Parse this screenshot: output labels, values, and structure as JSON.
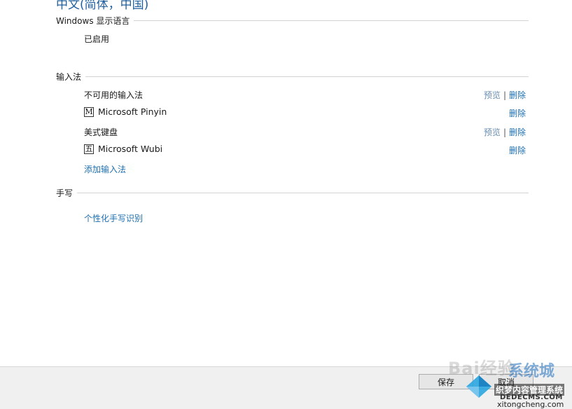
{
  "language_title": "中文(简体，中国)",
  "display_language": {
    "header": "Windows 显示语言",
    "status": "已启用"
  },
  "input_methods": {
    "header": "输入法",
    "groups": [
      {
        "label": "不可用的输入法",
        "preview": "预览",
        "separator": "|",
        "delete": "删除"
      },
      {
        "icon": "M",
        "name": "Microsoft Pinyin",
        "delete": "删除"
      },
      {
        "label": "美式键盘",
        "preview": "预览",
        "separator": "|",
        "delete": "删除"
      },
      {
        "icon": "五",
        "name": "Microsoft Wubi",
        "delete": "删除"
      }
    ],
    "add_link": "添加输入法"
  },
  "handwriting": {
    "header": "手写",
    "personalize_link": "个性化手写识别"
  },
  "footer": {
    "save": "保存",
    "cancel": "取消"
  },
  "watermarks": {
    "baidu": "Bai",
    "baidu_tail": "经验",
    "xitong": "系统城",
    "badge_text": "织梦内容管理系统",
    "dedecms": "DEDECMS.COM",
    "xitongcheng": "xitongcheng.com"
  },
  "colors": {
    "link": "#1e6fb0",
    "title": "#1f5e9c",
    "footer_bg": "#f0f0f0"
  }
}
